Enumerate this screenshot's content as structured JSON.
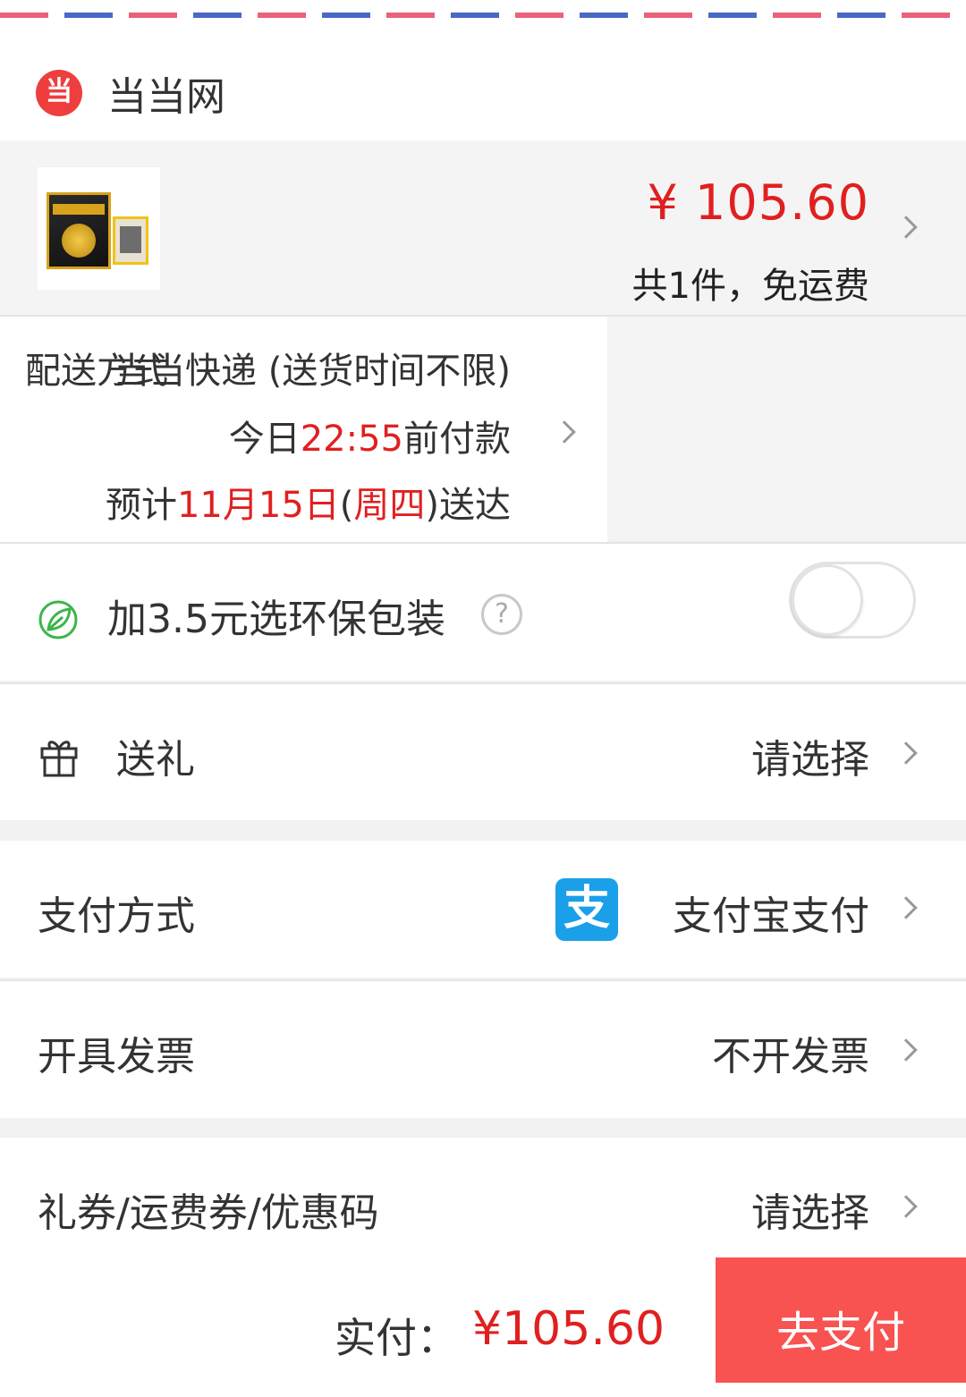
{
  "shop": {
    "name": "当当网",
    "logo_char": "当",
    "logo_icon": "dangdang-logo"
  },
  "product": {
    "price": "¥ 105.60",
    "count_text": "共1件，免运费"
  },
  "delivery": {
    "label": "配送方式",
    "method": "当当快递 (送货时间不限)",
    "pay_prefix": "今日",
    "pay_time": "22:55",
    "pay_suffix": "前付款",
    "eta_prefix": "预计",
    "eta_date": "11月15日",
    "eta_open": "(",
    "eta_weekday": "周四",
    "eta_close": ")送达"
  },
  "eco_packaging": {
    "label": "加3.5元选环保包装",
    "help": "?",
    "enabled": false
  },
  "gift": {
    "label": "送礼",
    "value": "请选择"
  },
  "payment": {
    "label": "支付方式",
    "icon_char": "支",
    "value": "支付宝支付"
  },
  "invoice": {
    "label": "开具发票",
    "value": "不开发票"
  },
  "coupon": {
    "label": "礼券/运费券/优惠码",
    "value": "请选择"
  },
  "footer": {
    "total_label": "实付：",
    "total_value": "¥105.60",
    "pay_button": "去支付"
  },
  "colors": {
    "accent_red": "#e02020",
    "pay_button": "#f85251",
    "alipay_blue": "#1aa0e8",
    "eco_green": "#3bb54a"
  }
}
